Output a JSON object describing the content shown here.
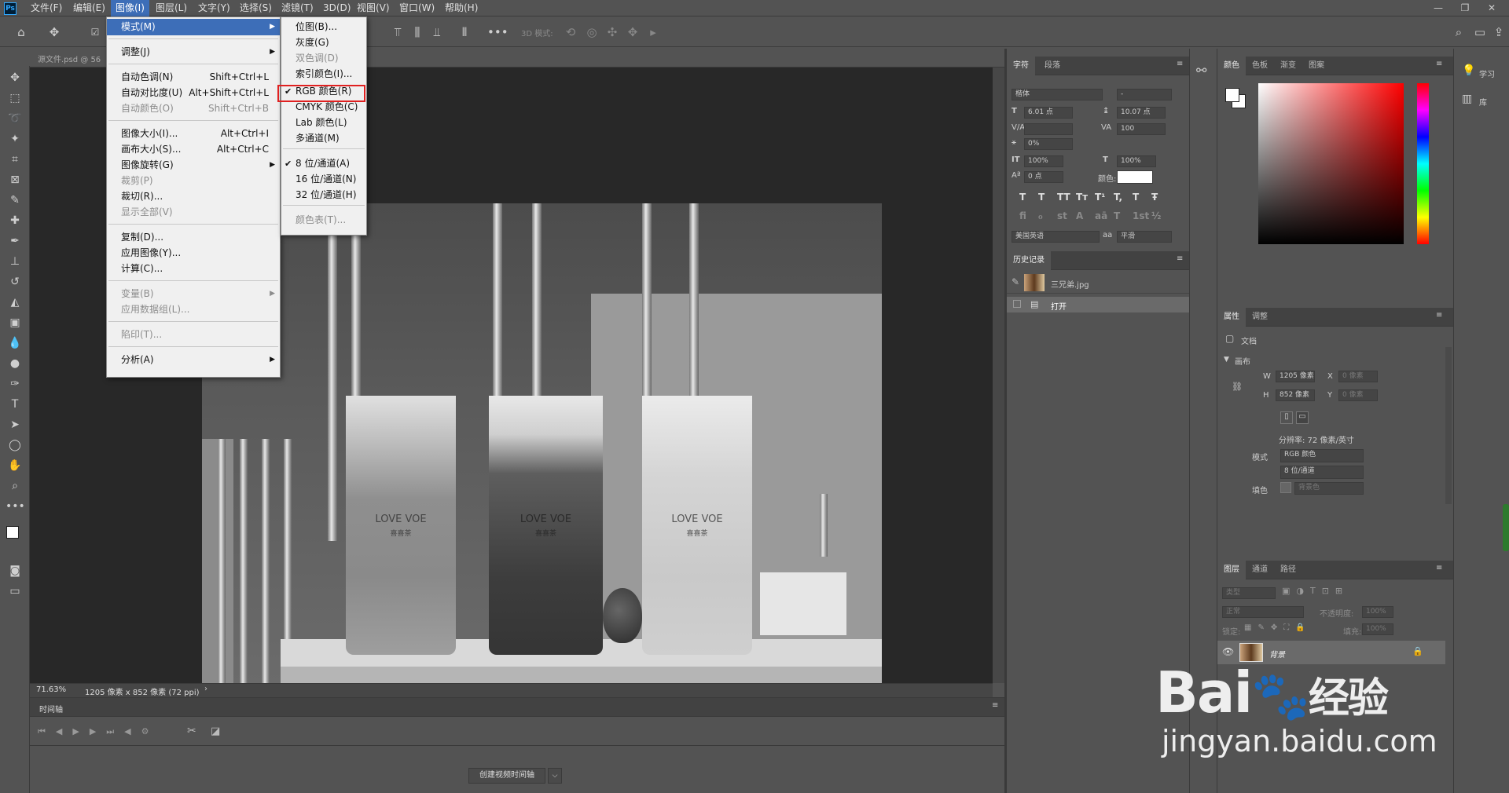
{
  "menubar": {
    "logo": "Ps",
    "items": [
      "文件(F)",
      "编辑(E)",
      "图像(I)",
      "图层(L)",
      "文字(Y)",
      "选择(S)",
      "滤镜(T)",
      "3D(D)",
      "视图(V)",
      "窗口(W)",
      "帮助(H)"
    ]
  },
  "window_controls": [
    "—",
    "❐",
    "✕"
  ],
  "options_bar": {
    "mode3d": "3D 模式:"
  },
  "document": {
    "tab_title": "源文件.psd @ 56",
    "zoom": "71.63%",
    "size_info": "1205 像素 x 852 像素 (72 ppi)"
  },
  "image_menu": {
    "items": [
      {
        "label": "模式(M)",
        "shortcut": "",
        "disabled": false,
        "sub": true,
        "hl": true
      },
      {
        "label": "调整(J)",
        "shortcut": "",
        "disabled": false,
        "sub": true
      },
      {
        "label": "自动色调(N)",
        "shortcut": "Shift+Ctrl+L",
        "disabled": false
      },
      {
        "label": "自动对比度(U)",
        "shortcut": "Alt+Shift+Ctrl+L",
        "disabled": false
      },
      {
        "label": "自动颜色(O)",
        "shortcut": "Shift+Ctrl+B",
        "disabled": true
      },
      {
        "label": "图像大小(I)...",
        "shortcut": "Alt+Ctrl+I",
        "disabled": false
      },
      {
        "label": "画布大小(S)...",
        "shortcut": "Alt+Ctrl+C",
        "disabled": false
      },
      {
        "label": "图像旋转(G)",
        "shortcut": "",
        "disabled": false,
        "sub": true
      },
      {
        "label": "裁剪(P)",
        "shortcut": "",
        "disabled": true
      },
      {
        "label": "裁切(R)...",
        "shortcut": "",
        "disabled": false
      },
      {
        "label": "显示全部(V)",
        "shortcut": "",
        "disabled": true
      },
      {
        "label": "复制(D)...",
        "shortcut": "",
        "disabled": false
      },
      {
        "label": "应用图像(Y)...",
        "shortcut": "",
        "disabled": false
      },
      {
        "label": "计算(C)...",
        "shortcut": "",
        "disabled": false
      },
      {
        "label": "变量(B)",
        "shortcut": "",
        "disabled": true,
        "sub": true
      },
      {
        "label": "应用数据组(L)...",
        "shortcut": "",
        "disabled": true
      },
      {
        "label": "陷印(T)...",
        "shortcut": "",
        "disabled": true
      },
      {
        "label": "分析(A)",
        "shortcut": "",
        "disabled": false,
        "sub": true
      }
    ]
  },
  "mode_menu": {
    "items": [
      {
        "label": "位图(B)...",
        "disabled": false,
        "checked": false
      },
      {
        "label": "灰度(G)",
        "disabled": false,
        "checked": false
      },
      {
        "label": "双色调(D)",
        "disabled": true,
        "checked": false
      },
      {
        "label": "索引颜色(I)...",
        "disabled": false,
        "checked": false
      },
      {
        "label": "RGB 颜色(R)",
        "disabled": false,
        "checked": true
      },
      {
        "label": "CMYK 颜色(C)",
        "disabled": false,
        "checked": false
      },
      {
        "label": "Lab 颜色(L)",
        "disabled": false,
        "checked": false
      },
      {
        "label": "多通道(M)",
        "disabled": false,
        "checked": false
      },
      {
        "label": "8 位/通道(A)",
        "disabled": false,
        "checked": true
      },
      {
        "label": "16 位/通道(N)",
        "disabled": false,
        "checked": false
      },
      {
        "label": "32 位/通道(H)",
        "disabled": false,
        "checked": false
      },
      {
        "label": "颜色表(T)...",
        "disabled": true,
        "checked": false
      }
    ]
  },
  "image_content": {
    "cup_text": "LOVE VOE",
    "cup_sub": "喜喜茶"
  },
  "character_panel": {
    "tabs": [
      "字符",
      "段落"
    ],
    "font": "楷体",
    "style": "-",
    "size": "6.01 点",
    "leading": "10.07 点",
    "tracking": "100",
    "scale_pct": "0%",
    "vscale": "100%",
    "hscale": "100%",
    "baseline": "0 点",
    "color_label": "颜色:",
    "language": "美国英语",
    "aa_label": "aa",
    "aa": "平滑",
    "styles": [
      "T",
      "T",
      "TT",
      "Tт",
      "T¹",
      "T,",
      "T",
      "Ŧ"
    ],
    "ot": [
      "fi",
      "ℴ",
      "st",
      "A",
      "aā",
      "T",
      "1st",
      "½"
    ]
  },
  "history_panel": {
    "title": "历史记录",
    "snapshot": "三兄弟.jpg",
    "step": "打开"
  },
  "color_panel": {
    "tabs": [
      "颜色",
      "色板",
      "渐变",
      "图案"
    ]
  },
  "learn_panel": {
    "items": [
      "学习",
      "库"
    ]
  },
  "properties_panel": {
    "tabs": [
      "属性",
      "调整"
    ],
    "doc_label": "文档",
    "canvas_label": "画布",
    "w_label": "W",
    "w": "1205 像素",
    "h_label": "H",
    "h": "852 像素",
    "x_label": "X",
    "x": "0 像素",
    "y_label": "Y",
    "y": "0 像素",
    "resolution": "分辨率: 72 像素/英寸",
    "mode_label": "模式",
    "mode": "RGB 颜色",
    "bits": "8 位/通道",
    "fill_label": "填色",
    "fill": "背景色"
  },
  "layers_panel": {
    "tabs": [
      "图层",
      "通道",
      "路径"
    ],
    "filter": "类型",
    "blend": "正常",
    "opacity_label": "不透明度:",
    "opacity": "100%",
    "lock_label": "锁定:",
    "fill_label": "填充:",
    "fill": "100%",
    "layer_name": "背景"
  },
  "timeline": {
    "title": "时间轴",
    "create_button": "创建视频时间轴"
  },
  "watermark": {
    "brand": "Bai",
    "brand2": "经验",
    "url": "jingyan.baidu.com"
  },
  "colors": {
    "accent": "#3d6eb8",
    "highlight_box": "#e02020"
  }
}
